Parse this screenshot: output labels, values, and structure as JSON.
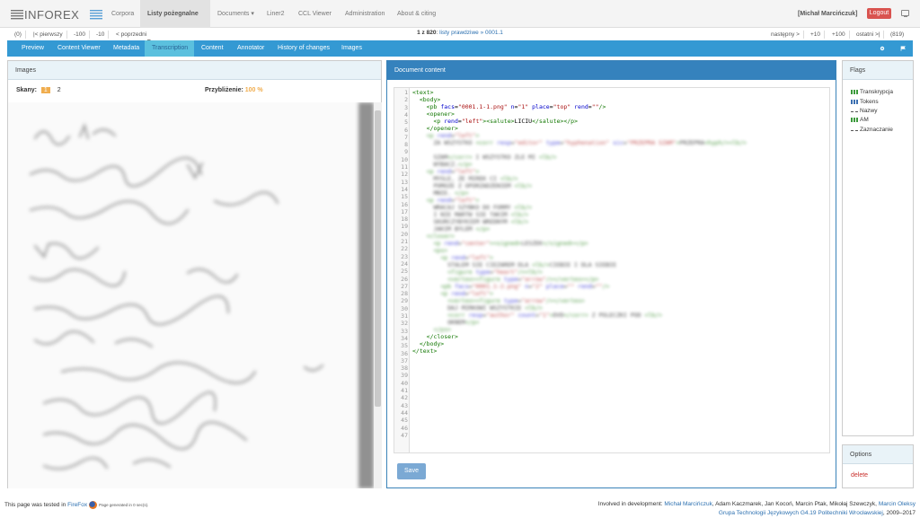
{
  "app": {
    "logo_text": "INFOREX"
  },
  "topnav": {
    "items": [
      {
        "label": "Corpora"
      },
      {
        "label": "Listy pożegnalne ▾"
      },
      {
        "label": "Documents ▾"
      },
      {
        "label": "Liner2"
      },
      {
        "label": "CCL Viewer"
      },
      {
        "label": "Administration"
      },
      {
        "label": "About & citing"
      }
    ],
    "user": "[Michał Marcińczuk]",
    "logout": "Logout"
  },
  "pager": {
    "count_left": "(0)",
    "first": "|< pierwszy",
    "minus100": "-100",
    "minus10": "-10",
    "prev": "< poprzedni",
    "position": "1 z 820",
    "doc_title": "listy prawdziwe » 0001.1",
    "next": "następny >",
    "plus10": "+10",
    "plus100": "+100",
    "last": "ostatni >|",
    "count_right": "(819)"
  },
  "tabs": [
    {
      "label": "Preview"
    },
    {
      "label": "Content Viewer"
    },
    {
      "label": "Metadata"
    },
    {
      "label": "Transcription"
    },
    {
      "label": "Content"
    },
    {
      "label": "Annotator"
    },
    {
      "label": "History of changes"
    },
    {
      "label": "Images"
    }
  ],
  "images_panel": {
    "title": "Images",
    "scans_label": "Skany:",
    "scan_pages": [
      "1",
      "2"
    ],
    "zoom_label": "Przybliżenie:",
    "zoom_value": "100 %"
  },
  "doc_panel": {
    "title": "Document content",
    "line_numbers": [
      "1",
      "2",
      "3",
      "4",
      "5",
      "6",
      "7",
      "8",
      "9",
      "10",
      "11",
      "12",
      "13",
      "14",
      "15",
      "16",
      "17",
      "18",
      "19",
      "20",
      "21",
      "22",
      "23",
      "24",
      "25",
      "26",
      "27",
      "28",
      "29",
      "30",
      "31",
      "32",
      "33",
      "34",
      "35",
      "36",
      "37",
      "38",
      "39",
      "40",
      "41",
      "42",
      "43",
      "44",
      "45",
      "46",
      "47"
    ],
    "save_label": "Save"
  },
  "flags_panel": {
    "title": "Flags",
    "items": [
      {
        "label": "Transkrypcja",
        "icon": "green-bars-icon"
      },
      {
        "label": "Tokens",
        "icon": "blue-bars-icon"
      },
      {
        "label": "Nazwy",
        "icon": "dash-icon"
      },
      {
        "label": "AM",
        "icon": "green-bars-icon"
      },
      {
        "label": "Zaznaczanie",
        "icon": "dash-icon"
      }
    ]
  },
  "options_panel": {
    "title": "Options",
    "delete": "delete"
  },
  "footer": {
    "tested_prefix": "This page was tested in",
    "firefox": "FireFox",
    "generated": "Page generated in 0 sec(s).",
    "involved_prefix": "Involved in development:",
    "lead": "Michał Marcińczuk",
    "others": ", Adam Kaczmarek, Jan Kocoń, Marcin Ptak, Mikołaj Szewczyk,",
    "last_dev": "Marcin Oleksy",
    "group": "Grupa Technologii Językowych G4.19 Politechniki Wrocławskiej",
    "years": ", 2009–2017"
  },
  "colors": {
    "accent": "#3499d3",
    "logout": "#d9534f",
    "highlight": "#f0ad4e",
    "panel_head": "#3582bd"
  }
}
